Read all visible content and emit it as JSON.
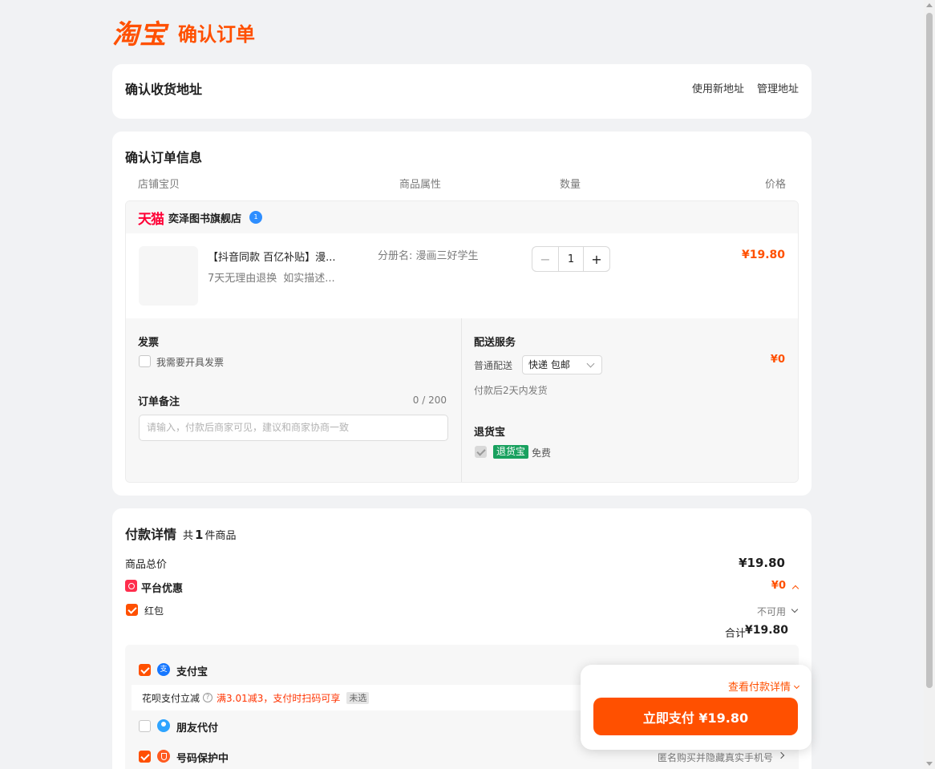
{
  "header": {
    "logo": "淘宝",
    "title": "确认订单"
  },
  "address": {
    "title": "确认收货地址",
    "new_link": "使用新地址",
    "manage_link": "管理地址"
  },
  "order": {
    "title": "确认订单信息",
    "columns": [
      "店铺宝贝",
      "商品属性",
      "数量",
      "价格"
    ],
    "shop": {
      "platform": "天猫",
      "name": "奕泽图书旗舰店"
    },
    "item": {
      "title": "【抖音同款 百亿补贴】漫...",
      "services": [
        "7天无理由退换",
        "如实描述..."
      ],
      "attr": "分册名: 漫画三好学生",
      "quantity": "1",
      "minus": "−",
      "plus": "+",
      "price": "¥19.80"
    },
    "invoice": {
      "label": "发票",
      "checkbox_label": "我需要开具发票"
    },
    "note": {
      "label": "订单备注",
      "counter": "0 / 200",
      "placeholder": "请输入，付款后商家可见，建议和商家协商一致"
    },
    "delivery": {
      "label": "配送服务",
      "type": "普通配送",
      "selected": "快递 包邮",
      "eta": "付款后2天内发货",
      "fee": "¥0"
    },
    "return_insurance": {
      "label": "退货宝",
      "tag": "退货宝",
      "price": "免费"
    }
  },
  "payment": {
    "title": "付款详情",
    "count_prefix": "共",
    "count": "1",
    "count_suffix": "件商品",
    "subtotal_label": "商品总价",
    "subtotal": "¥19.80",
    "platform_discount_label": "平台优惠",
    "platform_discount": "¥0",
    "red_packet_label": "红包",
    "red_packet_status": "不可用",
    "total_label": "合计",
    "total": "¥19.80",
    "methods": {
      "alipay": "支付宝",
      "huabei_label": "花呗支付立减",
      "huabei_q": "?",
      "huabei_promo": "满3.01减3，支付时扫码可享",
      "huabei_tag": "未选",
      "friend": "朋友代付",
      "number_protect": "号码保护中",
      "number_protect_desc": "匿名购买并隐藏真实手机号"
    }
  },
  "float_pay": {
    "detail_link": "查看付款详情",
    "button": "立即支付 ¥19.80"
  },
  "colors": {
    "accent": "#ff5000",
    "tmall_red": "#ff0036",
    "green": "#19a15f"
  }
}
